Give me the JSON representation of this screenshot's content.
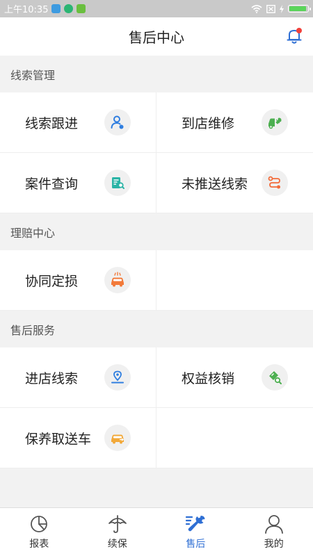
{
  "status_bar": {
    "time": "上午10:35"
  },
  "header": {
    "title": "售后中心",
    "bell_badge_color": "#f2403a"
  },
  "sections": [
    {
      "title": "线索管理",
      "items": [
        {
          "label": "线索跟进",
          "icon": "user-follow-icon",
          "color": "#2f7ee0"
        },
        {
          "label": "到店维修",
          "icon": "car-repair-icon",
          "color": "#4caf50"
        },
        {
          "label": "案件查询",
          "icon": "case-search-icon",
          "color": "#2bb4a6"
        },
        {
          "label": "未推送线索",
          "icon": "route-icon",
          "color": "#f26b3a"
        }
      ]
    },
    {
      "title": "理赔中心",
      "items": [
        {
          "label": "协同定损",
          "icon": "car-damage-icon",
          "color": "#f27a3a"
        }
      ]
    },
    {
      "title": "售后服务",
      "items": [
        {
          "label": "进店线索",
          "icon": "location-pin-icon",
          "color": "#2f7ee0"
        },
        {
          "label": "权益核销",
          "icon": "ticket-verify-icon",
          "color": "#4caf50"
        },
        {
          "label": "保养取送车",
          "icon": "car-pickup-icon",
          "color": "#f2a93a"
        }
      ]
    }
  ],
  "bottom_nav": [
    {
      "label": "报表",
      "icon": "pie-chart-icon",
      "active": false
    },
    {
      "label": "续保",
      "icon": "umbrella-icon",
      "active": false
    },
    {
      "label": "售后",
      "icon": "wrench-icon",
      "active": true
    },
    {
      "label": "我的",
      "icon": "person-icon",
      "active": false
    }
  ],
  "colors": {
    "accent": "#2f6fd4",
    "background": "#f2f2f2"
  }
}
